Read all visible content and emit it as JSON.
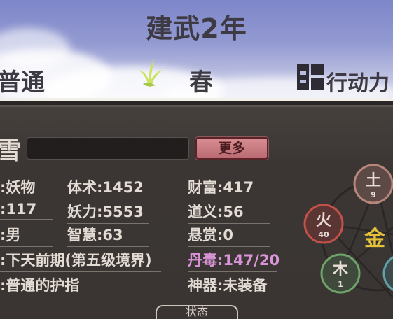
{
  "header": {
    "year": "建武2年",
    "difficulty": "普通",
    "season": "春",
    "action_label": "行动力",
    "season_icon": "plant-sprout-icon",
    "action_icon": "action-power-icon"
  },
  "profile": {
    "name_fragment": "雪",
    "name_value": "",
    "more_button": "更多",
    "stats_left": [
      ":妖物",
      ":117",
      ":男",
      ":下天前期(第五级境界)",
      ":普通的护指"
    ],
    "stats_mid": [
      "体术:1452",
      "妖力:5553",
      "智慧:63"
    ],
    "stats_right": [
      "财富:417",
      "道义:56",
      "悬赏:0",
      "丹毒:147/20",
      "神器:未装备"
    ],
    "highlight_color": "#d994d7"
  },
  "elements": {
    "earth": {
      "label": "土",
      "value": "9",
      "color": "#b9867a"
    },
    "fire": {
      "label": "火",
      "value": "40",
      "color": "#c0524a"
    },
    "metal": {
      "label": "金",
      "value": "",
      "color": "#e3c23a"
    },
    "wood": {
      "label": "木",
      "value": "1",
      "color": "#6fa36a"
    }
  },
  "bottom_tab": {
    "label": "状态"
  }
}
